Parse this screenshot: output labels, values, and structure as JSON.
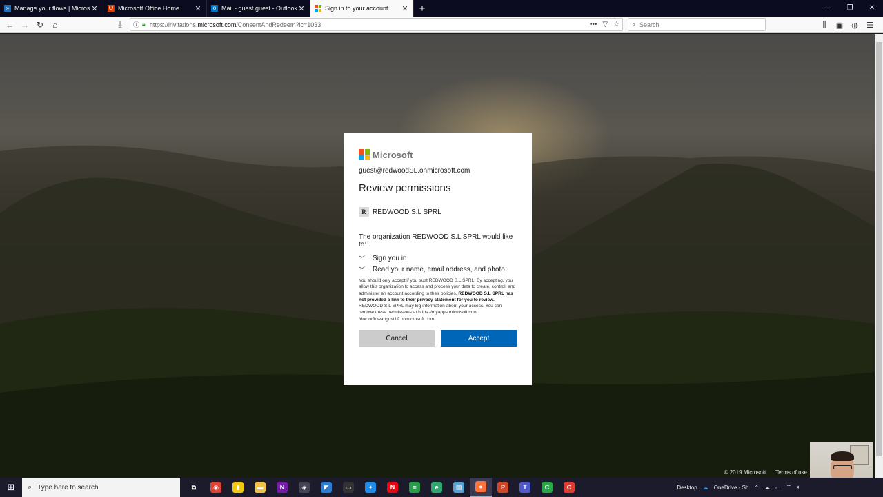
{
  "browser": {
    "tabs": [
      {
        "label": "Manage your flows | Microsoft",
        "icon": "flow-icon",
        "color": "#1d6fb8"
      },
      {
        "label": "Microsoft Office Home",
        "icon": "office-icon",
        "color": "#d83b01"
      },
      {
        "label": "Mail - guest guest - Outlook",
        "icon": "outlook-icon",
        "color": "#0072c6"
      },
      {
        "label": "Sign in to your account",
        "icon": "microsoft-icon",
        "color": "#f25022",
        "active": true
      }
    ],
    "url_prefix": "https://invitations.",
    "url_host": "microsoft.com",
    "url_path": "/ConsentAndRedeem?lc=1033",
    "search_placeholder": "Search"
  },
  "dialog": {
    "brand": "Microsoft",
    "email": "guest@redwoodSL.onmicrosoft.com",
    "title": "Review permissions",
    "org_initial": "R",
    "org_name": "REDWOOD S.L SPRL",
    "would_like": "The organization REDWOOD S.L SPRL would like to:",
    "permissions": [
      "Sign you in",
      "Read your name, email address, and photo"
    ],
    "fine_print_1": "You should only accept if you trust REDWOOD S.L SPRL. By accepting, you allow this organization to access and process your data to create, control, and administer an account according to their policies.",
    "fine_print_bold": "REDWOOD S.L SPRL has not provided a link to their privacy statement for you to review.",
    "fine_print_2": "REDWOOD S.L SPRL may log information about your access. You can remove these permissions at https://myapps.microsoft.com /doctorflowaugust19.onmicrosoft.com",
    "cancel_label": "Cancel",
    "accept_label": "Accept",
    "logo_colors": [
      "#f25022",
      "#7fba00",
      "#00a4ef",
      "#ffb900"
    ],
    "accent": "#0067b8"
  },
  "footer": {
    "copyright": "© 2019 Microsoft",
    "terms": "Terms of use"
  },
  "taskbar": {
    "search_placeholder": "Type here to search",
    "apps": [
      {
        "name": "task-view-icon",
        "glyph": "⧉",
        "color": "#1b1b2b"
      },
      {
        "name": "chrome-icon",
        "glyph": "◉",
        "color": "#db4437"
      },
      {
        "name": "powerbi-icon",
        "glyph": "▮",
        "color": "#f2c811"
      },
      {
        "name": "file-explorer-icon",
        "glyph": "▬",
        "color": "#f3c14b"
      },
      {
        "name": "onenote-icon",
        "glyph": "N",
        "color": "#7719aa"
      },
      {
        "name": "mindmap-icon",
        "glyph": "◈",
        "color": "#444455"
      },
      {
        "name": "visual-studio-icon",
        "glyph": "◤",
        "color": "#2d7dd2"
      },
      {
        "name": "terminal-icon",
        "glyph": "▭",
        "color": "#333"
      },
      {
        "name": "sync-icon",
        "glyph": "✦",
        "color": "#1f8ce8"
      },
      {
        "name": "netflix-icon",
        "glyph": "N",
        "color": "#e50914"
      },
      {
        "name": "stack-icon",
        "glyph": "≡",
        "color": "#2a9d4b"
      },
      {
        "name": "edge-icon",
        "glyph": "e",
        "color": "#2fa86f"
      },
      {
        "name": "notepad-icon",
        "glyph": "▤",
        "color": "#5aa0d0"
      },
      {
        "name": "firefox-icon",
        "glyph": "●",
        "color": "#ff7139",
        "active": true
      },
      {
        "name": "powerpoint-icon",
        "glyph": "P",
        "color": "#d24726"
      },
      {
        "name": "teams-icon",
        "glyph": "T",
        "color": "#5059c9"
      },
      {
        "name": "camtasia-green-icon",
        "glyph": "C",
        "color": "#28a745"
      },
      {
        "name": "camtasia-red-icon",
        "glyph": "C",
        "color": "#e03c31"
      }
    ],
    "tray_desktop": "Desktop",
    "tray_onedrive": "OneDrive - Sh"
  }
}
